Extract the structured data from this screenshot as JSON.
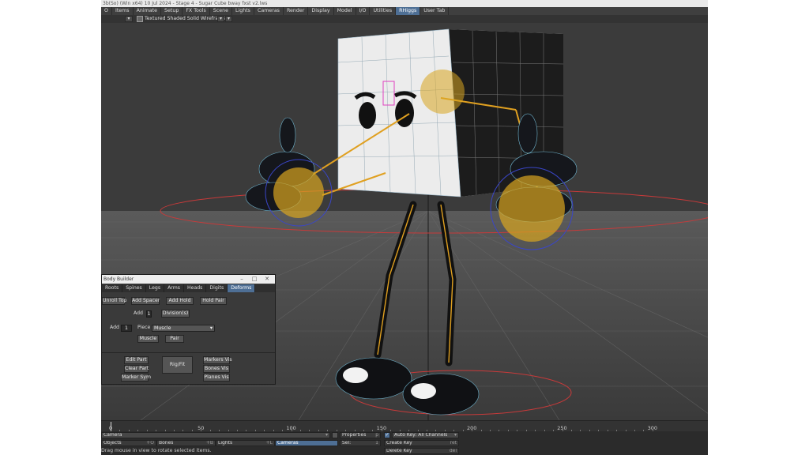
{
  "app": {
    "title": "3b(So) (Win x64) 10 Jul 2024 - Stage 4 - Sugar Cube bway fxst v2.lws"
  },
  "menu": {
    "tabs": [
      "O",
      "Items",
      "Animate",
      "Setup",
      "FX Tools",
      "Scene",
      "Lights",
      "Cameras",
      "Render",
      "Display",
      "Model",
      "I/O",
      "Utilities",
      "RHiggs",
      "User Tab"
    ],
    "active": "RHiggs"
  },
  "viewport": {
    "view_mode": "Textured Shaded Solid Wireframe"
  },
  "body_builder": {
    "title": "Body Builder",
    "tabs": [
      "Roots",
      "Spines",
      "Legs",
      "Arms",
      "Heads",
      "Digits",
      "Deforms"
    ],
    "active_tab": "Deforms",
    "buttons": {
      "roll_top": "Unroll Top",
      "add_spacer": "Add Spacer",
      "add_hold": "Add Hold",
      "hold_pair": "Hold Pair",
      "divisions": "Division(s)",
      "muscle": "Muscle",
      "pair": "Pair",
      "edit_part": "Edit Part",
      "clear_part": "Clear Part",
      "marker_sym": "Marker Sym",
      "rig_fit": "Rig/Fit",
      "markers_vis": "Markers Vis",
      "bones_vis": "Bones Vis",
      "planes_vis": "Planes Vis"
    },
    "labels": {
      "add1": "Add",
      "add2": "Add",
      "piece": "Piece"
    },
    "fields": {
      "add1_value": "1",
      "add2_value": "1",
      "piece_value": "Muscle"
    }
  },
  "timeline": {
    "labels": [
      "0",
      "50",
      "100",
      "150",
      "200",
      "250",
      "300"
    ],
    "current_frame": "0"
  },
  "bottom": {
    "camera": "Camera",
    "properties": "Properties",
    "auto_key": "Auto Key: All Channels",
    "objects": "Objects",
    "objects_shortcut": "+O",
    "bones": "Bones",
    "bones_shortcut": "+B",
    "lights": "Lights",
    "lights_shortcut": "+L",
    "cameras": "Cameras",
    "sel_label": "Sel:",
    "sel_value": "1",
    "create_key": "Create Key",
    "create_key_shortcut": "ret",
    "delete_key": "Delete Key",
    "delete_key_shortcut": "del",
    "status": "Drag mouse in view to rotate selected items."
  }
}
